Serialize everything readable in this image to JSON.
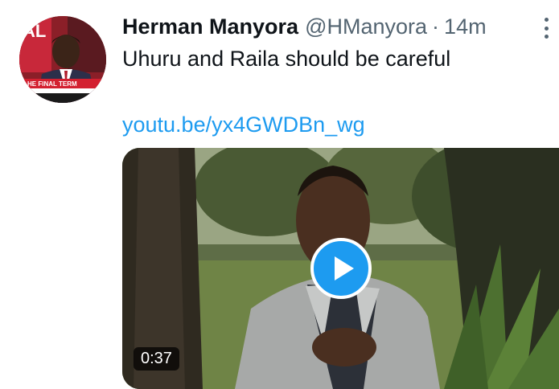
{
  "tweet": {
    "display_name": "Herman Manyora",
    "handle": "@HManyora",
    "separator": "·",
    "time": "14m",
    "text": "Uhuru and Raila should be careful",
    "link": "youtu.be/yx4GWDBn_wg"
  },
  "avatar": {
    "banner_text": "HE FINAL TERM",
    "top_text": "AL"
  },
  "video": {
    "duration": "0:37"
  },
  "icons": {
    "more": "more-icon",
    "play": "play-icon"
  },
  "colors": {
    "name": "#0f1419",
    "secondary": "#536471",
    "link": "#1d9bf0",
    "play_button": "#1d9bf0"
  }
}
